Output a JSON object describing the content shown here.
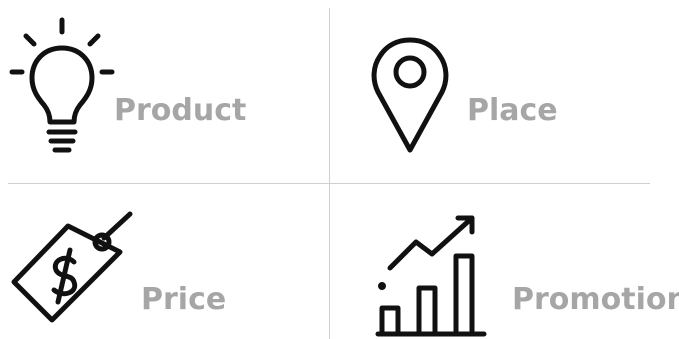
{
  "colors": {
    "icon_stroke": "#111111",
    "label_text": "#a6a6a6",
    "divider": "#cfcfcf",
    "background": "#ffffff"
  },
  "quadrants": [
    {
      "label": "Product",
      "icon": "lightbulb-icon"
    },
    {
      "label": "Place",
      "icon": "map-pin-icon"
    },
    {
      "label": "Price",
      "icon": "price-tag-icon"
    },
    {
      "label": "Promotion",
      "icon": "growth-chart-icon"
    }
  ]
}
